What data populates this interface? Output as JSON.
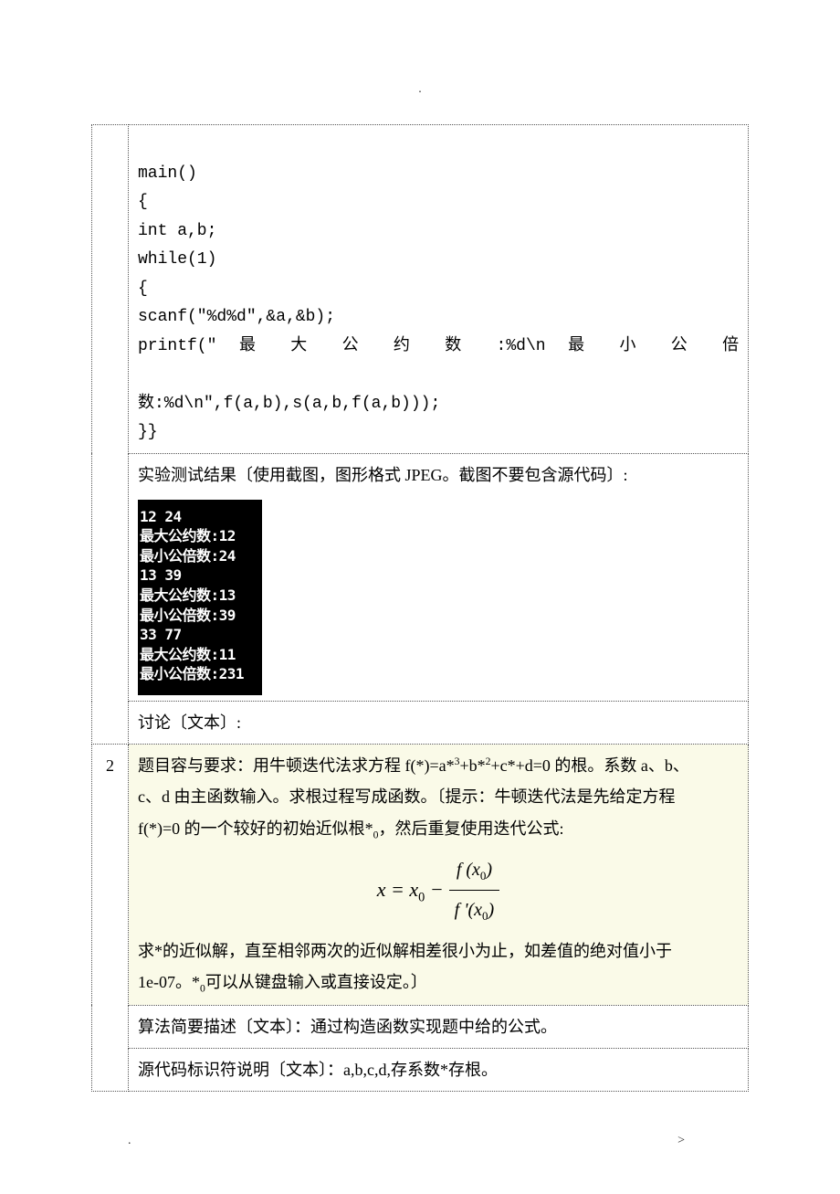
{
  "top_marker": ".",
  "row1": {
    "code": {
      "l1": "main()",
      "l2": "{",
      "l3": "int a,b;",
      "l4": "while(1)",
      "l5": "{",
      "l6": "scanf(\"%d%d\",&a,&b);",
      "l7a": "printf(\"",
      "l7b": "最",
      "l7c": "大",
      "l7d": "公",
      "l7e": "约",
      "l7f": "数",
      "l7g": ":%d\\n",
      "l7h": "最",
      "l7i": "小",
      "l7j": "公",
      "l7k": "倍",
      "l8": "数:%d\\n\",f(a,b),s(a,b,f(a,b)));",
      "l9": "}}"
    }
  },
  "row2": {
    "title": "实验测试结果〔使用截图，图形格式 JPEG。截图不要包含源代码〕:",
    "terminal": "12 24\n最大公约数:12\n最小公倍数:24\n13 39\n最大公约数:13\n最小公倍数:39\n33 77\n最大公约数:11\n最小公倍数:231"
  },
  "row3": {
    "text": "讨论〔文本〕:"
  },
  "row4": {
    "num": "2",
    "p1": "题目容与要求：用牛顿迭代法求方程 f(*)=a*",
    "p1_sup1": "3",
    "p1b": "+b*",
    "p1_sup2": "2",
    "p1c": "+c*+d=0 的根。系数 a、b、",
    "p2": "c、d 由主函数输入。求根过程写成函数。〔提示：牛顿迭代法是先给定方程",
    "p3a": "f(*)=0 的一个较好的初始近似根*",
    "p3_sub": "0",
    "p3b": "，然后重复使用迭代公式:",
    "formula": {
      "left": "x = x",
      "left_sub": "0",
      "minus": " − ",
      "num_a": "f (x",
      "num_sub": "0",
      "num_b": ")",
      "den_a": "f '(x",
      "den_sub": "0",
      "den_b": ")"
    },
    "p4": "求*的近似解，直至相邻两次的近似解相差很小为止，如差值的绝对值小于",
    "p5a": "1e-07。*",
    "p5_sub": "0",
    "p5b": "可以从键盘输入或直接设定。〕"
  },
  "row5": {
    "text": "算法简要描述〔文本〕：通过构造函数实现题中给的公式。"
  },
  "row6": {
    "text": "源代码标识符说明〔文本〕：a,b,c,d,存系数*存根。"
  },
  "footer": {
    "left": ".",
    "right": ">"
  }
}
